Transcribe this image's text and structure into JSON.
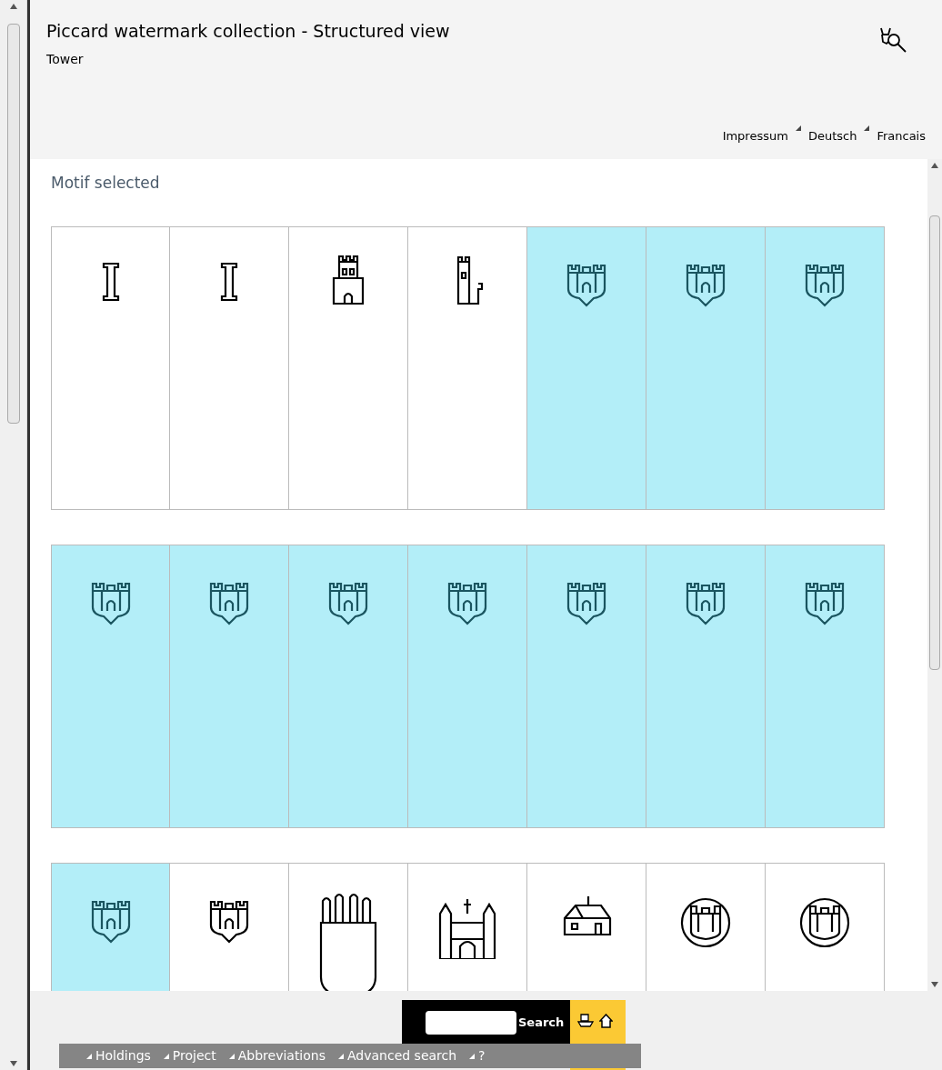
{
  "header": {
    "title": "Piccard watermark collection - Structured view",
    "subtitle": "Tower",
    "links": [
      "Impressum",
      "Deutsch",
      "Francais"
    ]
  },
  "section_title": "Motif selected",
  "motifs": [
    {
      "kind": "column",
      "selected": false
    },
    {
      "kind": "column",
      "selected": false
    },
    {
      "kind": "castle",
      "selected": false
    },
    {
      "kind": "tower",
      "selected": false
    },
    {
      "kind": "shield",
      "selected": true
    },
    {
      "kind": "shield",
      "selected": true
    },
    {
      "kind": "shield",
      "selected": true
    },
    {
      "kind": "shield",
      "selected": true
    },
    {
      "kind": "shield",
      "selected": true
    },
    {
      "kind": "shield",
      "selected": true
    },
    {
      "kind": "shield",
      "selected": true
    },
    {
      "kind": "shield",
      "selected": true
    },
    {
      "kind": "shield",
      "selected": true
    },
    {
      "kind": "shield",
      "selected": true
    },
    {
      "kind": "shield",
      "selected": true
    },
    {
      "kind": "shield",
      "selected": false
    },
    {
      "kind": "tall-shield",
      "selected": false
    },
    {
      "kind": "church",
      "selected": false
    },
    {
      "kind": "house",
      "selected": false
    },
    {
      "kind": "seal",
      "selected": false
    },
    {
      "kind": "seal",
      "selected": false
    }
  ],
  "search": {
    "button": "Search"
  },
  "nav": [
    "Holdings",
    "Project",
    "Abbreviations",
    "Advanced search",
    "?"
  ]
}
